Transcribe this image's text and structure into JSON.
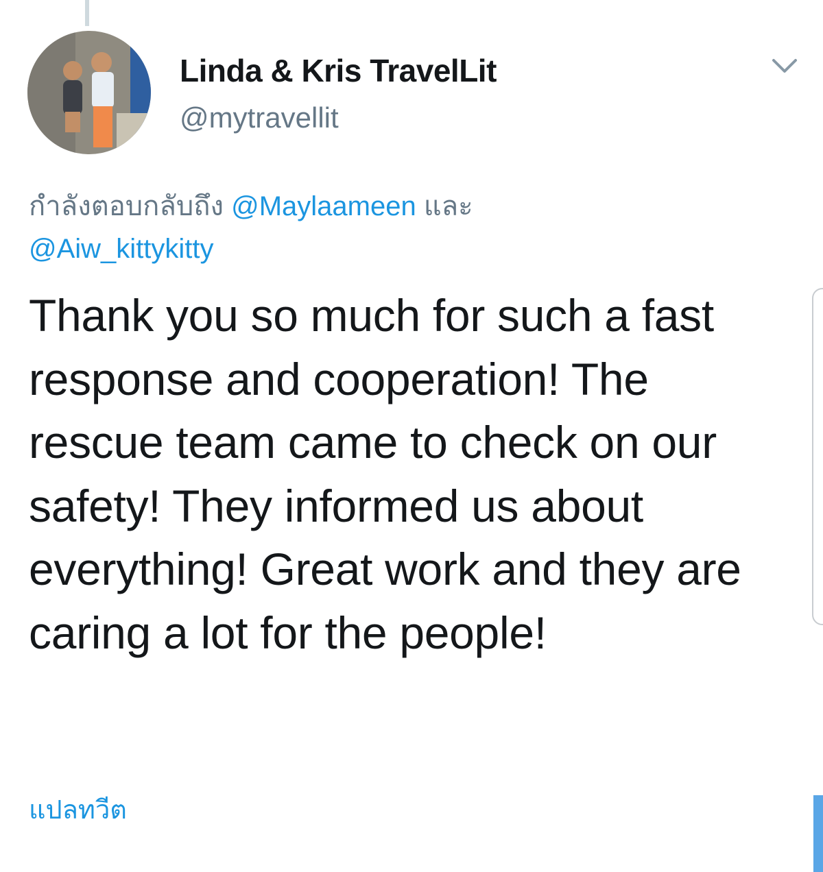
{
  "tweet": {
    "author_name": "Linda & Kris TravelLit",
    "author_handle": "@mytravellit",
    "reply_prefix": "กำลังตอบกลับถึง",
    "reply_mentions": [
      "@Maylaameen",
      "@Aiw_kittykitty"
    ],
    "reply_joiner": "และ",
    "text": "Thank you so much for such a fast response and cooperation! The rescue team came to check on our safety! They informed us about everything! Great work and they are caring a lot for the people!",
    "translate_label": "แปลทวีต"
  },
  "icons": {
    "menu": "chevron-down-icon",
    "avatar": "profile-photo"
  },
  "colors": {
    "link": "#1b95e0",
    "secondary_text": "#657786",
    "primary_text": "#14171a"
  }
}
